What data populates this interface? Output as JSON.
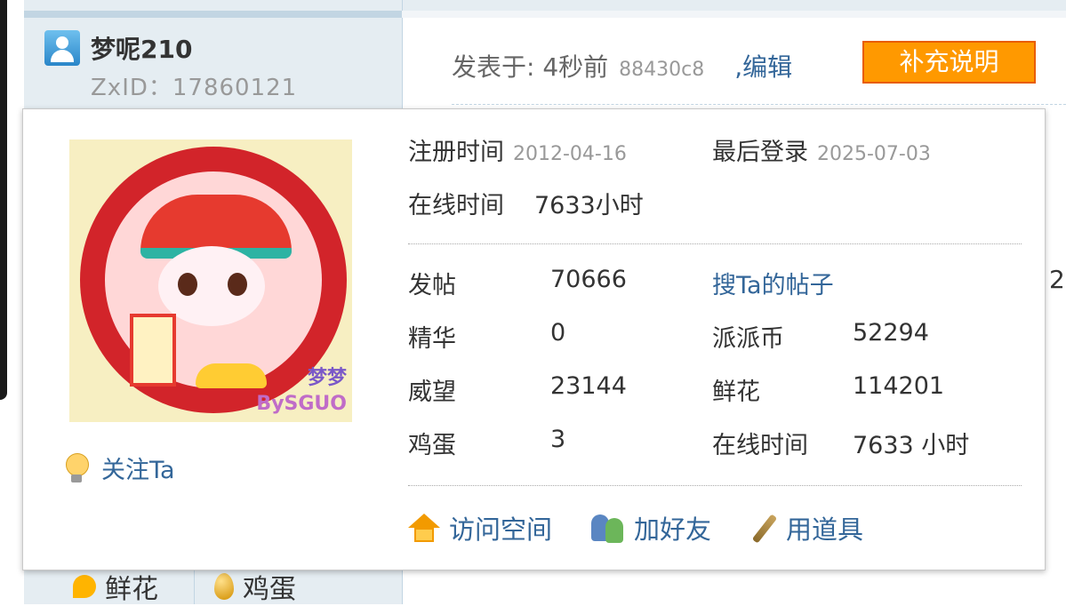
{
  "author": {
    "name": "梦呢210",
    "zxid": "ZxID：17860121"
  },
  "post": {
    "posted_label": "发表于: 4秒前",
    "hash": "88430c8",
    "edit_label": ",编辑",
    "supplement_button": "补充说明",
    "edge_text": "2"
  },
  "profile_card": {
    "avatar_tag_top": "梦梦",
    "avatar_tag_bottom": "BySGUO",
    "follow_label": "关注Ta",
    "register": {
      "label": "注册时间",
      "value": "2012-04-16"
    },
    "last_login": {
      "label": "最后登录",
      "value": "2025-07-03"
    },
    "online": {
      "label": "在线时间",
      "value": "7633小时"
    },
    "stats": [
      {
        "label": "发帖",
        "value": "70666",
        "label2": "搜Ta的帖子",
        "value2": ""
      },
      {
        "label": "精华",
        "value": "0",
        "label2": "派派币",
        "value2": "52294"
      },
      {
        "label": "威望",
        "value": "23144",
        "label2": "鲜花",
        "value2": "114201"
      },
      {
        "label": "鸡蛋",
        "value": "3",
        "label2": "在线时间",
        "value2": "7633 小时"
      }
    ],
    "actions": {
      "visit": "访问空间",
      "add_friend": "加好友",
      "use_tool": "用道具"
    }
  },
  "bottom_actions": {
    "flower": "鲜花",
    "egg": "鸡蛋"
  },
  "colors": {
    "link": "#336699",
    "accent_button": "#ff9900",
    "sidebar_bg": "#e5edf2"
  }
}
